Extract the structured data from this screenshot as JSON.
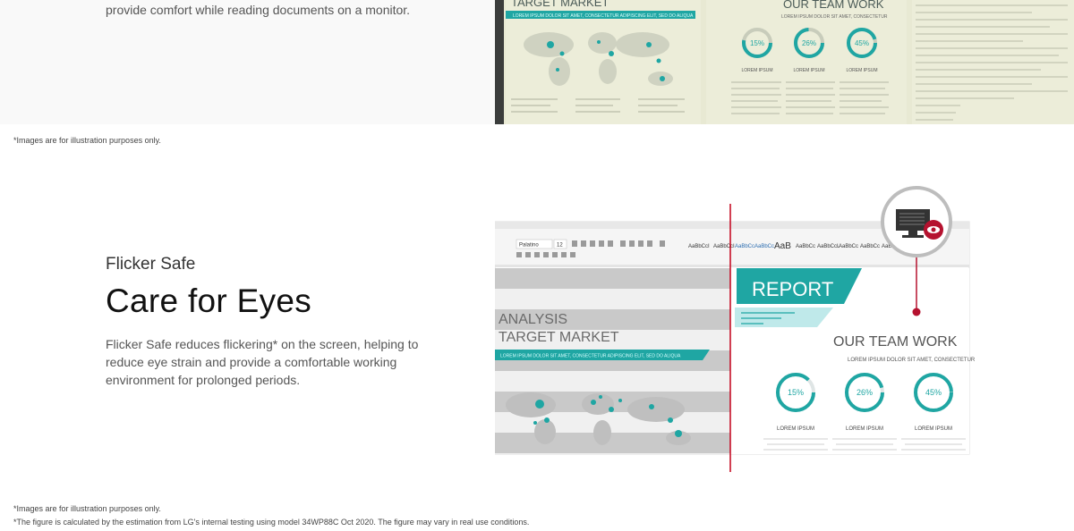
{
  "top_section": {
    "text": "provide comfort while reading documents on a monitor.",
    "figure": {
      "heading_left": "TARGET MARKET",
      "heading_right": "OUR TEAM WORK",
      "banner": "LOREM IPSUM DOLOR SIT AMET, CONSECTETUR ADIPISCING ELIT, SED DO ALIQUA",
      "subtitle": "LOREM IPSUM DOLOR SIT AMET, CONSECTETUR",
      "rings": [
        "15%",
        "26%",
        "45%"
      ],
      "ring_caption": "LOREM IPSUM"
    }
  },
  "notes": {
    "illustration_1": "*Images are for illustration purposes only.",
    "illustration_2": "*Images are for illustration purposes only.",
    "testing": "*The figure is calculated by the estimation from LG's internal testing using model 34WP88C Oct 2020. The figure may vary in real use conditions."
  },
  "feature": {
    "eyebrow": "Flicker Safe",
    "headline": "Care for Eyes",
    "body": "Flicker Safe reduces flickering* on the screen, helping to reduce eye strain and provide a comfortable working environment for prolonged periods."
  },
  "figure": {
    "left_title_1": "ANALYSIS",
    "left_title_2": "TARGET MARKET",
    "left_banner": "LOREM IPSUM DOLOR SIT AMET, CONSECTETUR ADIPISCING ELIT, SED DO ALIQUA",
    "report": "REPORT",
    "team_work": "OUR TEAM WORK",
    "team_subtitle": "LOREM IPSUM DOLOR SIT AMET, CONSECTETUR",
    "rings": [
      "15%",
      "26%",
      "45%"
    ],
    "ring_caption": "LOREM IPSUM",
    "font_box": "Palatino",
    "size_box": "12",
    "styles": [
      "AaBbCcI",
      "AaBbCcI",
      "AaBbCc",
      "AaBbCc",
      "AaB",
      "AaBbCc",
      "AaBbCcL",
      "AaBbCc",
      "AaBbCc",
      "AaBl"
    ],
    "colors": {
      "teal": "#1fa6a3",
      "red": "#b5122f",
      "ruler": "#c4001a"
    }
  }
}
